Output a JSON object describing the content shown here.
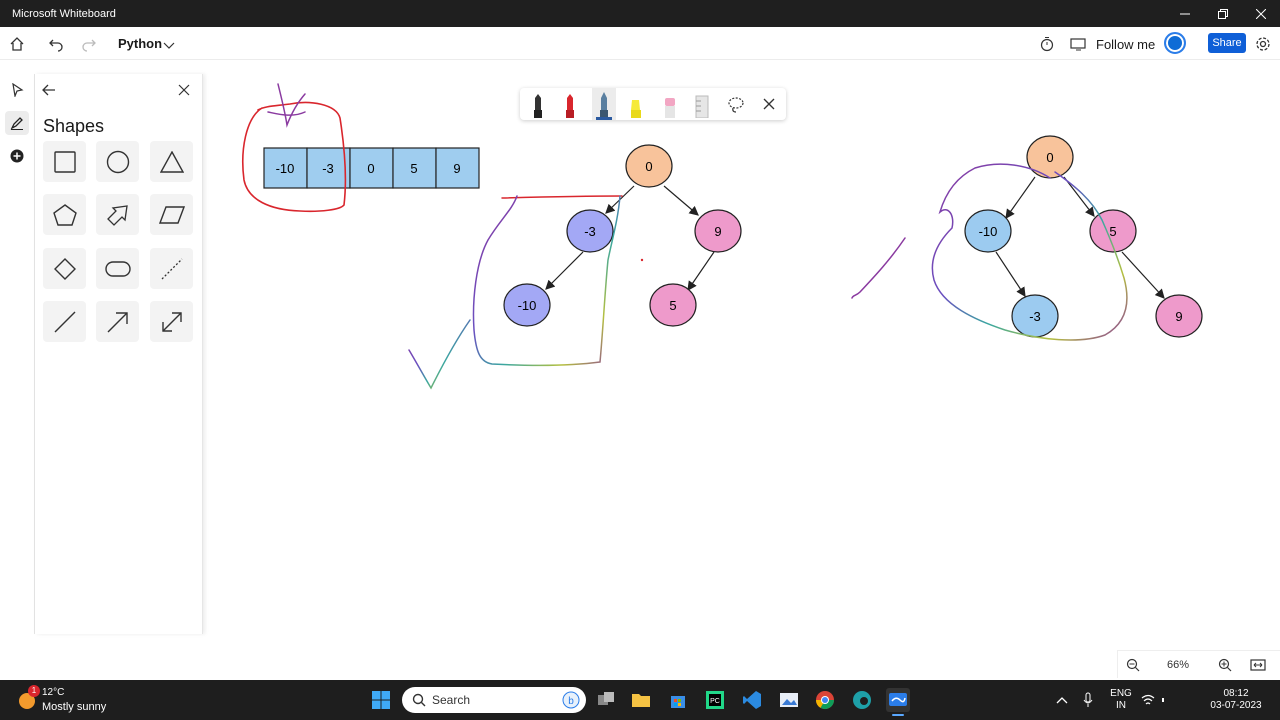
{
  "window": {
    "title": "Microsoft Whiteboard"
  },
  "appbar": {
    "board_name": "Python",
    "follow_label": "Follow me",
    "share_label": "Share"
  },
  "panel": {
    "title": "Shapes"
  },
  "array_cells": [
    "-10",
    "-3",
    "0",
    "5",
    "9"
  ],
  "tree1": {
    "root": "0",
    "left": "-3",
    "right": "9",
    "left_left": "-10",
    "right_left": "5"
  },
  "tree2": {
    "root": "0",
    "left": "-10",
    "right": "5",
    "left_right": "-3",
    "right_right": "9"
  },
  "zoom": {
    "value": "66%"
  },
  "taskbar": {
    "weather_temp": "12°C",
    "weather_desc": "Mostly sunny",
    "weather_badge": "1",
    "search_label": "Search",
    "lang_line1": "ENG",
    "lang_line2": "IN",
    "time": "08:12",
    "date": "03-07-2023"
  },
  "colors": {
    "orange_node": "#f8c39b",
    "purple_node": "#a3a8f5",
    "pink_node": "#ee9acb",
    "blue_node": "#9ccbf0",
    "array_fill": "#9fcdef",
    "red_ink": "#d9262d",
    "purple_ink": "#8a3aa0",
    "accent": "#0f5fd7"
  }
}
